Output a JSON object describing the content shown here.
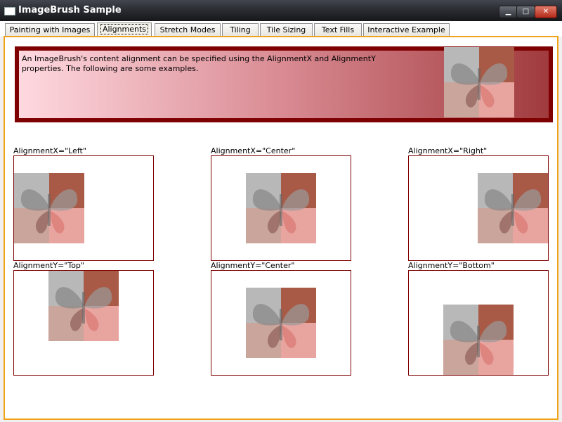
{
  "window": {
    "title": "ImageBrush Sample",
    "controls": {
      "minimize": "▁",
      "maximize": "□",
      "close": "✕"
    }
  },
  "tabs": [
    {
      "label": "Painting with Images"
    },
    {
      "label": "Alignments",
      "selected": true
    },
    {
      "label": "Stretch Modes"
    },
    {
      "label": "Tiling"
    },
    {
      "label": "Tile Sizing"
    },
    {
      "label": "Text Fills"
    },
    {
      "label": "Interactive Example"
    }
  ],
  "banner": {
    "text": "An ImageBrush's content alignment can be specified using the AlignmentX and AlignmentY properties. The following are some examples."
  },
  "examples": [
    {
      "label": "AlignmentX=\"Left\""
    },
    {
      "label": "AlignmentX=\"Center\""
    },
    {
      "label": "AlignmentX=\"Right\""
    },
    {
      "label": "AlignmentY=\"Top\""
    },
    {
      "label": "AlignmentY=\"Center\""
    },
    {
      "label": "AlignmentY=\"Bottom\""
    }
  ],
  "colors": {
    "accent_border": "#f0a31a",
    "panel_border": "#7f0000",
    "banner_border": "#7f0000"
  }
}
